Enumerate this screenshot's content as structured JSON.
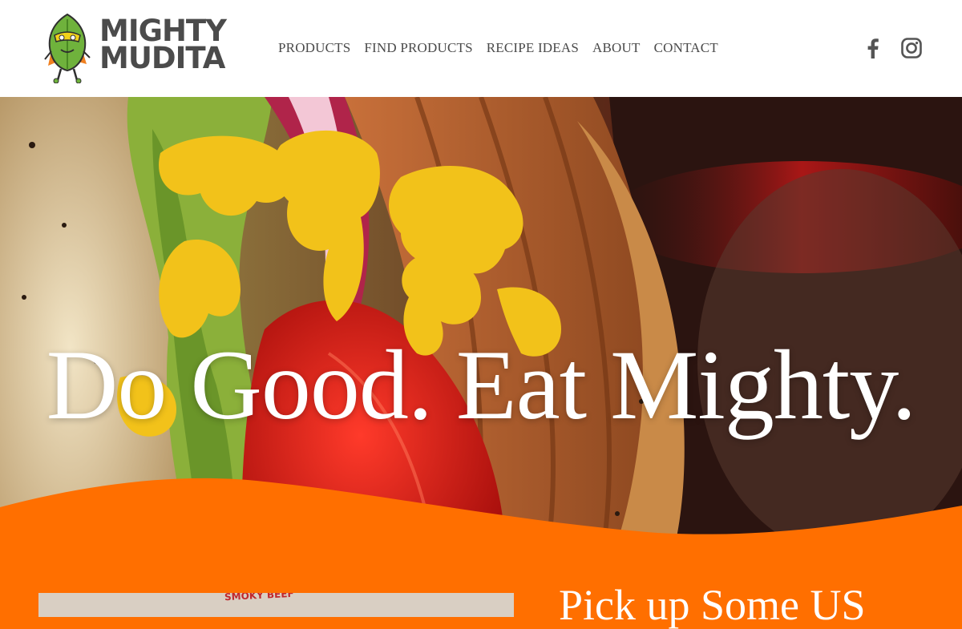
{
  "brand": {
    "line1": "MIGHTY",
    "line2": "MUDITA",
    "tm": "™"
  },
  "nav": {
    "items": [
      {
        "label": "PRODUCTS"
      },
      {
        "label": "FIND PRODUCTS"
      },
      {
        "label": "RECIPE IDEAS"
      },
      {
        "label": "ABOUT"
      },
      {
        "label": "CONTACT"
      }
    ]
  },
  "social": [
    {
      "icon": "facebook-icon"
    },
    {
      "icon": "instagram-icon"
    }
  ],
  "hero": {
    "title": "Do Good. Eat Mighty.",
    "image": "vegan-sandwich-with-mustard-tomato-and-sliced-plant-based-meat"
  },
  "section": {
    "heading": "Pick up Some US",
    "photo_label": "SMOKY BEEF"
  },
  "colors": {
    "accent": "#ff6f00",
    "nav_text": "#4a4a4a",
    "logo_text": "#4b4b4b",
    "header_bg": "#ffffff"
  }
}
